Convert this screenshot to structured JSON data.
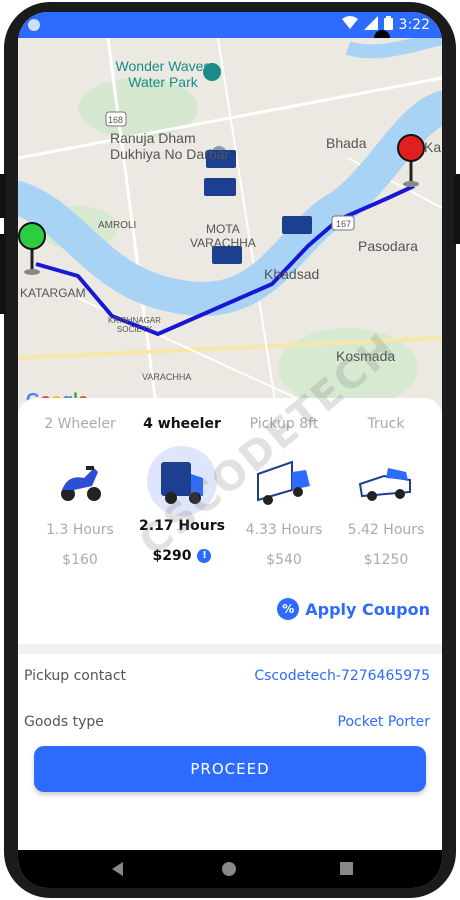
{
  "status_bar": {
    "time": "3:22"
  },
  "map": {
    "labels": {
      "poi_name": "Wonder Waves Water Park",
      "poi_line1": "Wonder Waves",
      "poi_line2": "Water Park",
      "ranuja_line1": "Ranuja Dham",
      "ranuja_line2": "Dukhiya No Darbar",
      "bhada": "Bhada",
      "ka": "Ka",
      "amroli": "AMROLI",
      "mota_line1": "MOTA",
      "mota_line2": "VARACHHA",
      "pasodara": "Pasodara",
      "khadsad": "Khadsad",
      "katargam": "KATARGAM",
      "krishnagar_line1": "KRISHNAGAR",
      "krishnagar_line2": "SOCIETY",
      "kosmada": "Kosmada",
      "varachha": "VARACHHA",
      "road_168": "168",
      "road_167": "167"
    },
    "google_logo": [
      "G",
      "o",
      "o",
      "g",
      "l",
      "e"
    ],
    "google_colors": [
      "#4285f4",
      "#ea4335",
      "#fbbc05",
      "#4285f4",
      "#34a853",
      "#ea4335"
    ],
    "route_color": "#1a16d6",
    "start_pin_color": "#2ecc40",
    "end_pin_color": "#e02020"
  },
  "vehicles": [
    {
      "name": "2 Wheeler",
      "hours": "1.3 Hours",
      "price": "$160",
      "icon": "scooter-icon",
      "selected": false
    },
    {
      "name": "4 wheeler",
      "hours": "2.17 Hours",
      "price": "$290",
      "icon": "van-icon",
      "selected": true
    },
    {
      "name": "Pickup 8ft",
      "hours": "4.33 Hours",
      "price": "$540",
      "icon": "truck-icon",
      "selected": false
    },
    {
      "name": "Truck",
      "hours": "5.42 Hours",
      "price": "$1250",
      "icon": "pickup-truck-icon",
      "selected": false
    }
  ],
  "coupon": {
    "label": "Apply Coupon",
    "icon_glyph": "%"
  },
  "details": {
    "pickup_label": "Pickup contact",
    "pickup_value": "Cscodetech-7276465975",
    "goods_label": "Goods type",
    "goods_value": "Pocket Porter"
  },
  "proceed_label": "PROCEED",
  "watermark": "CSCODETECH",
  "colors": {
    "primary": "#2d6bff",
    "selected_bg": "#dfe6fb"
  }
}
